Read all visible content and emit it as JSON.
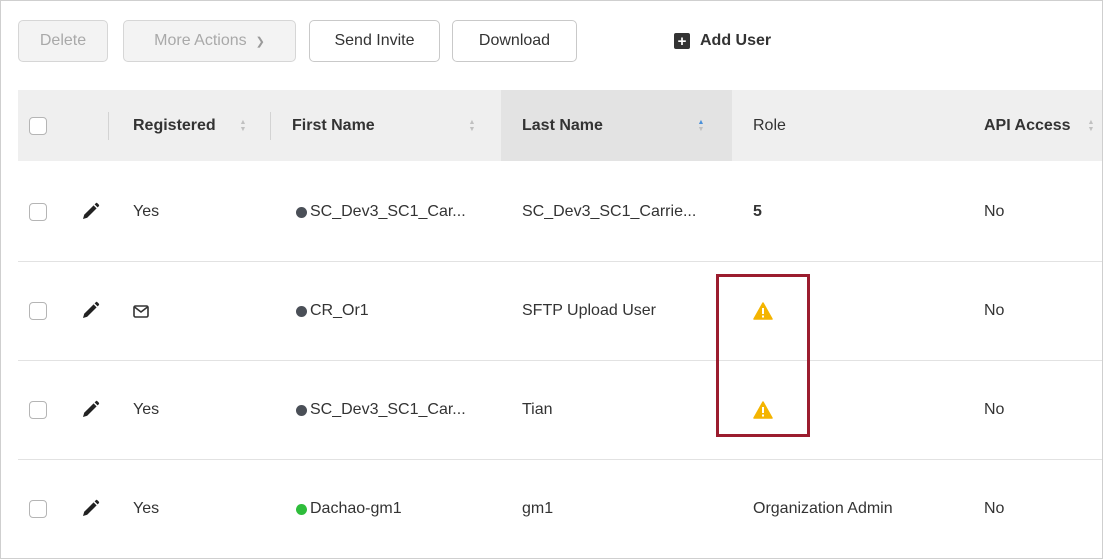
{
  "toolbar": {
    "delete_label": "Delete",
    "more_actions_label": "More Actions",
    "send_invite_label": "Send Invite",
    "download_label": "Download",
    "add_user_label": "Add User"
  },
  "table": {
    "headers": {
      "registered": "Registered",
      "first_name": "First Name",
      "last_name": "Last Name",
      "role": "Role",
      "api_access": "API Access"
    },
    "rows": [
      {
        "registered": "Yes",
        "registered_icon": "",
        "status_color": "#4a4f57",
        "first_name": "SC_Dev3_SC1_Car...",
        "last_name": "SC_Dev3_SC1_Carrie...",
        "role": "5",
        "role_warning": false,
        "api_access": "No"
      },
      {
        "registered": "",
        "registered_icon": "envelope-icon",
        "status_color": "#4a4f57",
        "first_name": "CR_Or1",
        "last_name": "SFTP Upload User",
        "role": "",
        "role_warning": true,
        "api_access": "No"
      },
      {
        "registered": "Yes",
        "registered_icon": "",
        "status_color": "#4a4f57",
        "first_name": "SC_Dev3_SC1_Car...",
        "last_name": "Tian",
        "role": "",
        "role_warning": true,
        "api_access": "No"
      },
      {
        "registered": "Yes",
        "registered_icon": "",
        "status_color": "#2ebd3b",
        "first_name": "Dachao-gm1",
        "last_name": "gm1",
        "role": "Organization Admin",
        "role_warning": false,
        "api_access": "No"
      }
    ]
  },
  "colors": {
    "warning": "#f4b400",
    "highlight_border": "#9b1c2e",
    "sort_active": "#4a90d9"
  }
}
